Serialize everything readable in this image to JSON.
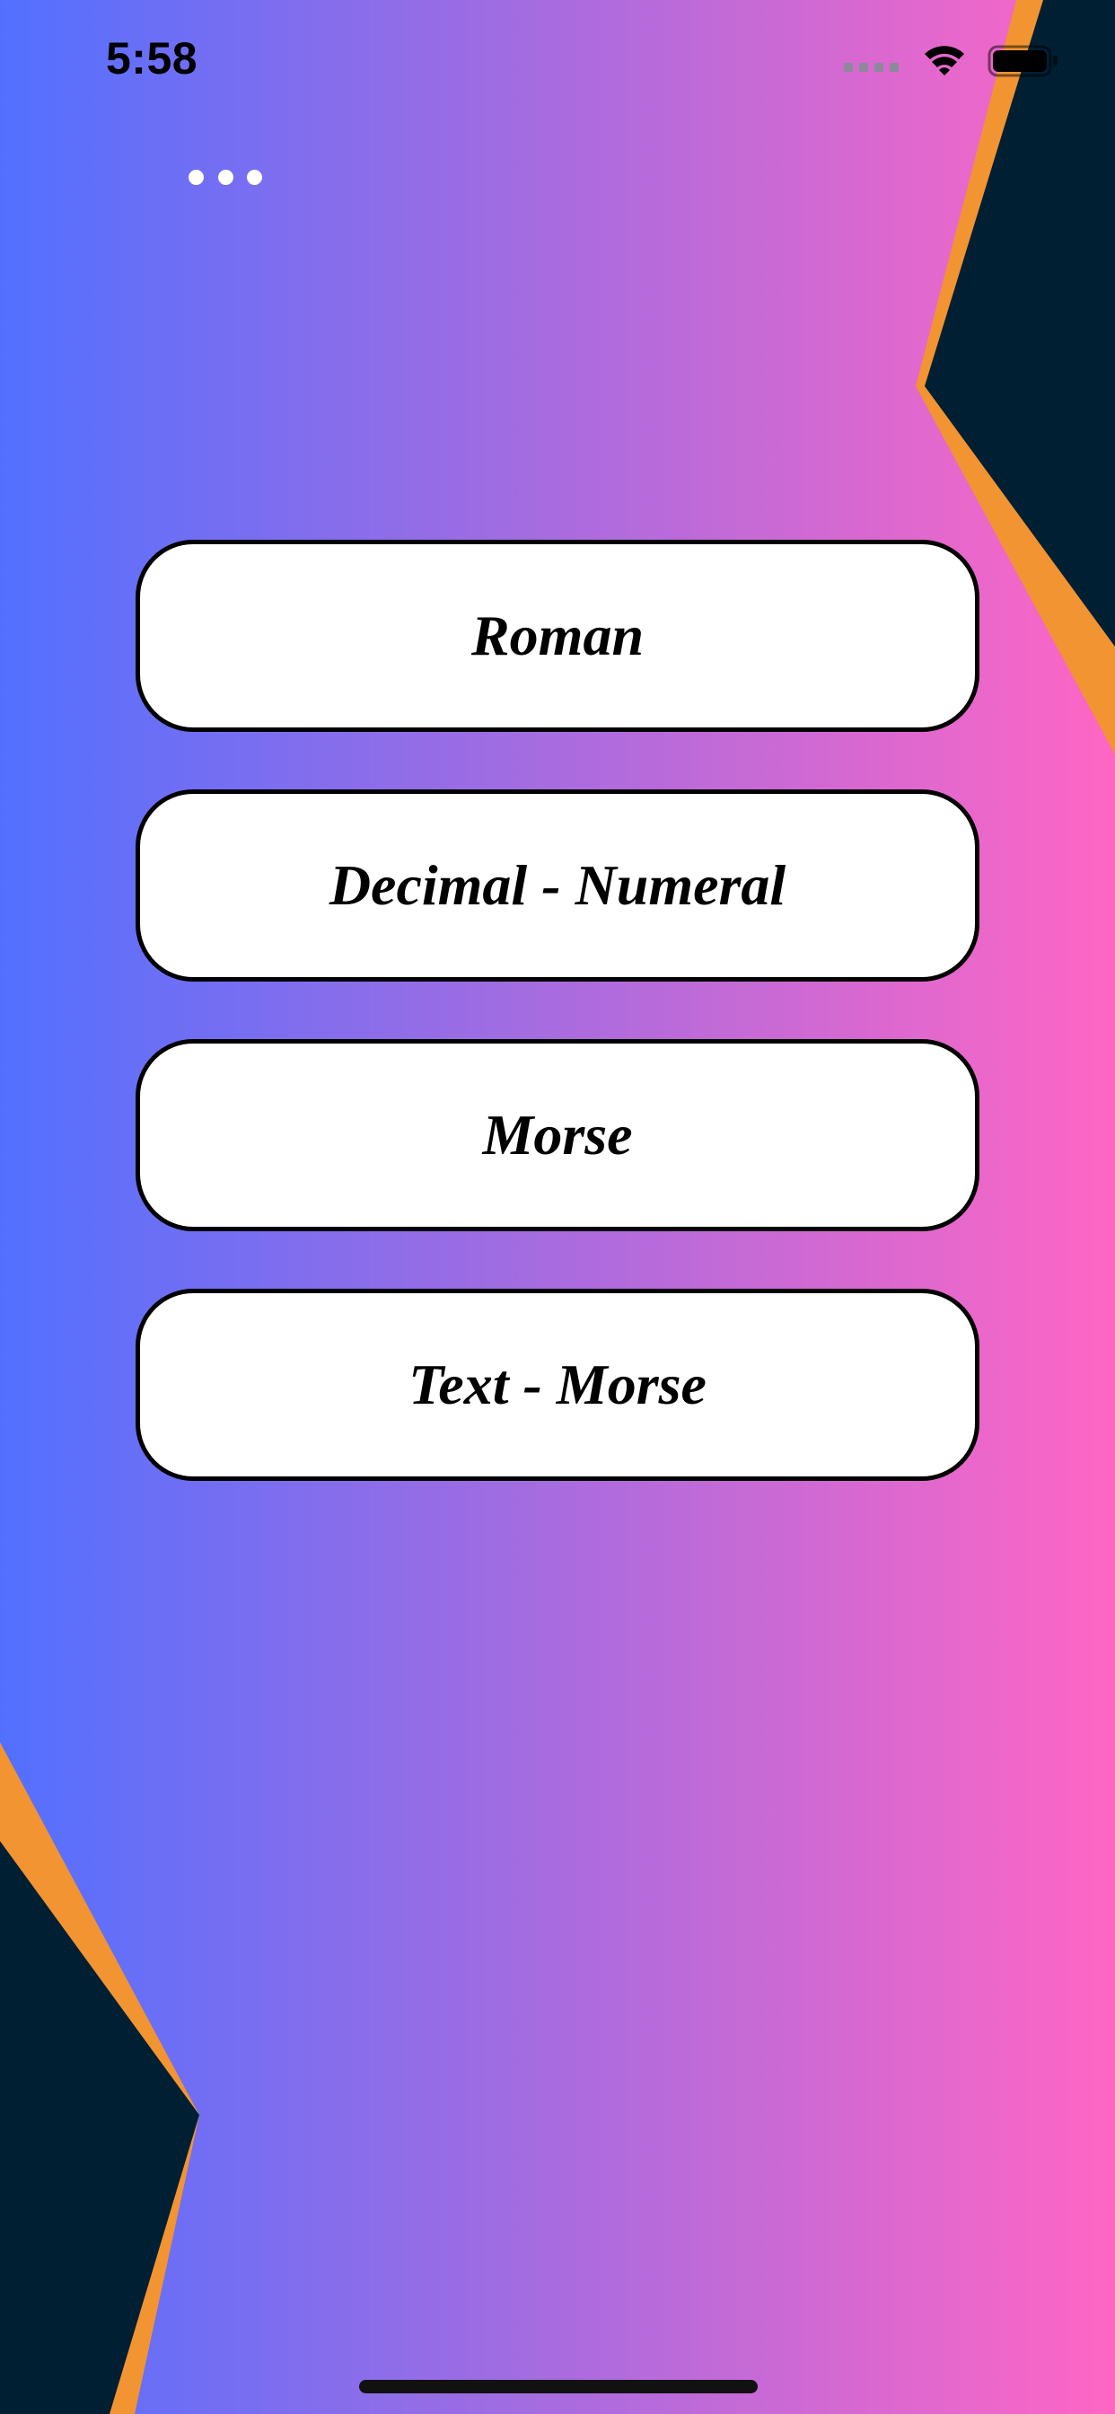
{
  "status_bar": {
    "time": "5:58",
    "icons": [
      "signal-icon",
      "wifi-icon",
      "battery-icon"
    ]
  },
  "menu": {
    "icon": "more-dots-icon"
  },
  "options": [
    {
      "label": "Roman"
    },
    {
      "label": "Decimal - Numeral"
    },
    {
      "label": "Morse"
    },
    {
      "label": "Text - Morse"
    }
  ],
  "colors": {
    "gradient_start": "#5270ff",
    "gradient_end": "#ff66c4",
    "decor_dark": "#001f33",
    "decor_accent": "#f29432",
    "button_fill": "#ffffff",
    "button_border": "#000000"
  }
}
